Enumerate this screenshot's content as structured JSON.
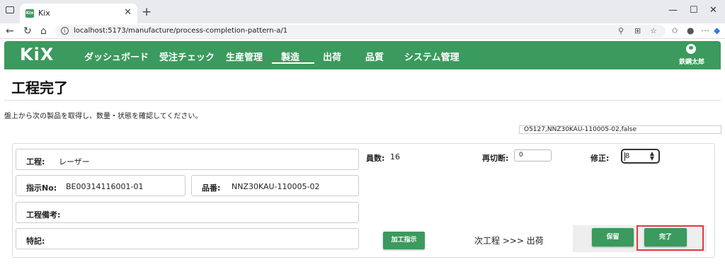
{
  "browser": {
    "tab_title": "Kix",
    "tab_favicon_text": "Kix",
    "url": "localhost:5173/manufacture/process-completion-pattern-a/1",
    "accent": "#3b9a5d"
  },
  "nav": {
    "logo": "KiX",
    "items": [
      "ダッシュボード",
      "受注チェック",
      "生産管理",
      "製造",
      "出荷",
      "品質",
      "システム管理"
    ],
    "active": "製造",
    "user_name": "鉄鋼太郎"
  },
  "page": {
    "title": "工程完了",
    "instruction": "盤上から次の製品を取得し、数量・状態を確認してください。",
    "scan_value": "O5127,NNZ30KAU-110005-02,false"
  },
  "form": {
    "process_label": "工程:",
    "process_value": "レーザー",
    "order_no_label": "指示No:",
    "order_no_value": "BE00314116001-01",
    "part_no_label": "品番:",
    "part_no_value": "NNZ30KAU-110005-02",
    "process_note_label": "工程備考:",
    "process_note_value": "",
    "remarks_label": "特記:",
    "remarks_value": "",
    "count_label": "員数:",
    "count_value": "16",
    "recut_label": "再切断:",
    "recut_value": "0",
    "correction_label": "修正:",
    "correction_value": "8"
  },
  "actions": {
    "work_instruction_label": "加工指示",
    "next_process_text": "次工程 >>> 出荷",
    "hold_label": "保留",
    "complete_label": "完了"
  }
}
